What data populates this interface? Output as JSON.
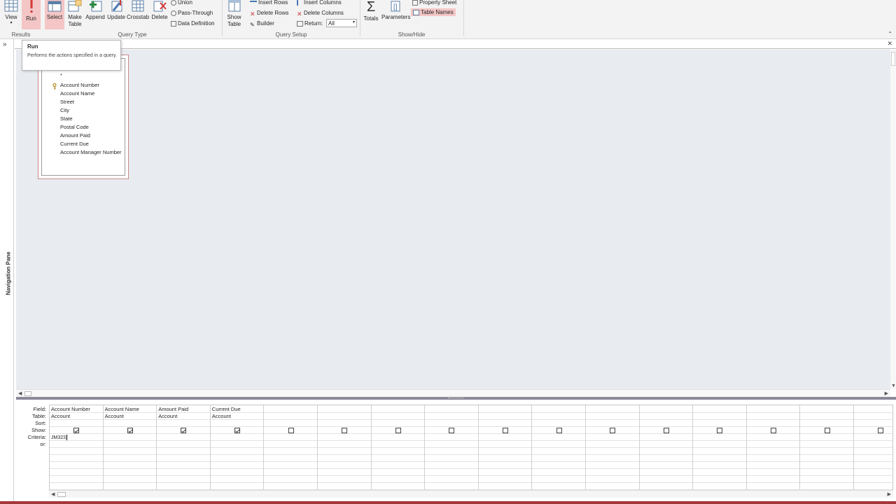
{
  "ribbon": {
    "view_label": "View",
    "run_label": "Run",
    "select_label": "Select",
    "make_table_label": "Make\nTable",
    "append_label": "Append",
    "update_label": "Update",
    "crosstab_label": "Crosstab",
    "delete_label": "Delete",
    "union_label": "Union",
    "pass_through_label": "Pass-Through",
    "data_definition_label": "Data Definition",
    "show_table_label": "Show\nTable",
    "insert_rows_label": "Insert Rows",
    "delete_rows_label": "Delete Rows",
    "builder_label": "Builder",
    "insert_columns_label": "Insert Columns",
    "delete_columns_label": "Delete Columns",
    "return_label": "Return:",
    "return_value": "All",
    "totals_label": "Totals",
    "parameters_label": "Parameters",
    "property_sheet_label": "Property Sheet",
    "table_names_label": "Table Names",
    "groups": {
      "results": "Results",
      "query_type": "Query Type",
      "query_setup": "Query Setup",
      "show_hide": "Show/Hide"
    }
  },
  "navigation_pane": {
    "toggle": "»",
    "label": "Navigation Pane"
  },
  "document": {
    "close": "✕"
  },
  "tooltip": {
    "title": "Run",
    "description": "Performs the actions specified in a query."
  },
  "table_box": {
    "asterisk": "*",
    "fields": [
      "Account Number",
      "Account Name",
      "Street",
      "City",
      "State",
      "Postal Code",
      "Amount Paid",
      "Current Due",
      "Account Manager Number"
    ]
  },
  "design_grid": {
    "row_labels": [
      "Field:",
      "Table:",
      "Sort:",
      "Show:",
      "Criteria:",
      "or:"
    ],
    "columns": [
      {
        "field": "Account Number",
        "table": "Account",
        "show": true,
        "criteria": "JM323"
      },
      {
        "field": "Account Name",
        "table": "Account",
        "show": true,
        "criteria": ""
      },
      {
        "field": "Amount Paid",
        "table": "Account",
        "show": true,
        "criteria": ""
      },
      {
        "field": "Current Due",
        "table": "Account",
        "show": true,
        "criteria": ""
      },
      {
        "field": "",
        "table": "",
        "show": false,
        "criteria": ""
      },
      {
        "field": "",
        "table": "",
        "show": false,
        "criteria": ""
      },
      {
        "field": "",
        "table": "",
        "show": false,
        "criteria": ""
      },
      {
        "field": "",
        "table": "",
        "show": false,
        "criteria": ""
      },
      {
        "field": "",
        "table": "",
        "show": false,
        "criteria": ""
      },
      {
        "field": "",
        "table": "",
        "show": false,
        "criteria": ""
      },
      {
        "field": "",
        "table": "",
        "show": false,
        "criteria": ""
      },
      {
        "field": "",
        "table": "",
        "show": false,
        "criteria": ""
      },
      {
        "field": "",
        "table": "",
        "show": false,
        "criteria": ""
      },
      {
        "field": "",
        "table": "",
        "show": false,
        "criteria": ""
      },
      {
        "field": "",
        "table": "",
        "show": false,
        "criteria": ""
      },
      {
        "field": "",
        "table": "",
        "show": false,
        "criteria": ""
      }
    ]
  },
  "colors": {
    "highlight": "#f4c6c6",
    "accent_red": "#a4373a",
    "design_bg": "#e8ebf0"
  }
}
